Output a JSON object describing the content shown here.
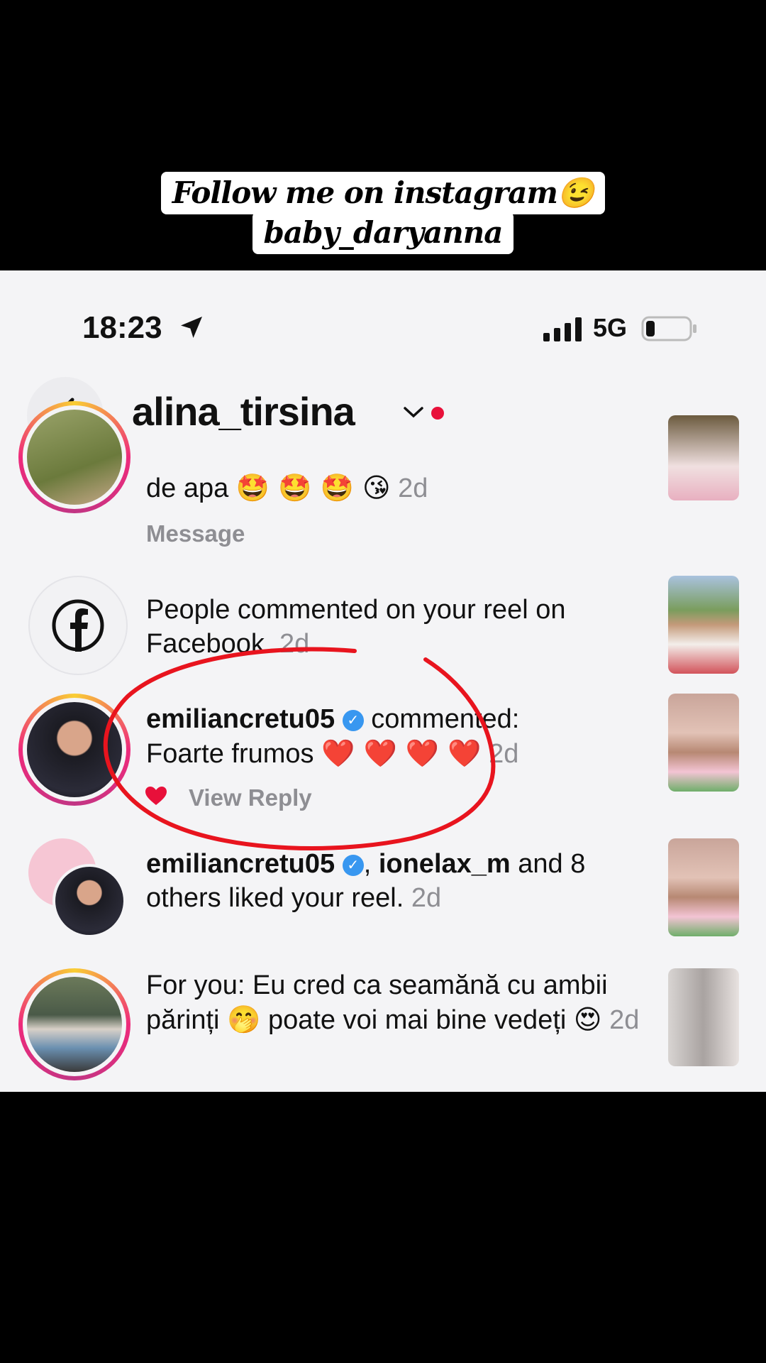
{
  "caption": {
    "line1": "Follow me on instagram😉",
    "line2": "baby_daryanna"
  },
  "status_bar": {
    "time": "18:23",
    "network": "5G"
  },
  "header": {
    "username": "alina_tirsina"
  },
  "notifications": [
    {
      "text": "de apa",
      "emojis": "🤩 🤩 🤩 😘",
      "age": "2d",
      "action": "Message"
    },
    {
      "text": "People commented on your reel on Facebook.",
      "age": "2d"
    },
    {
      "user": "emiliancretu05",
      "verb": "commented:",
      "comment": "Foarte frumos",
      "hearts": "❤️ ❤️ ❤️ ❤️",
      "age": "2d",
      "action": "View Reply"
    },
    {
      "user": "emiliancretu05",
      "sep": ",",
      "user2": "ionelax_m",
      "tail": "and 8 others liked your reel.",
      "age": "2d"
    },
    {
      "text": "For you: Eu cred ca seamănă cu ambii părinți",
      "emoji1": "🤭",
      "text2": "poate voi mai bine vedeți",
      "emoji2": "😍",
      "age": "2d"
    }
  ],
  "colors": {
    "accent_red": "#e8103a",
    "verified_blue": "#3897f0",
    "muted": "#8e8e93"
  }
}
